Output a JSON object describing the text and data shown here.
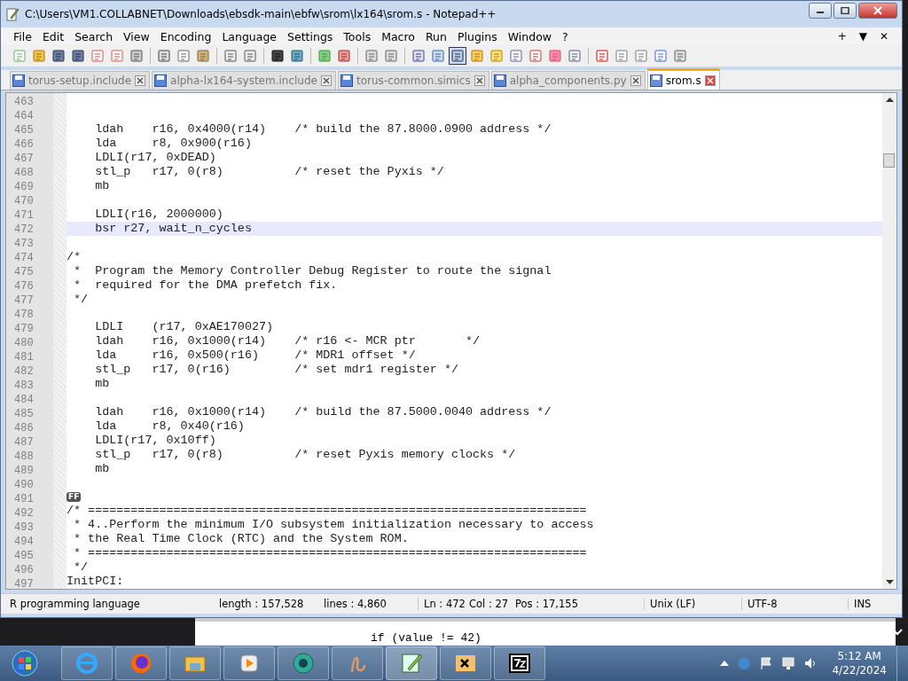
{
  "window": {
    "title": "C:\\Users\\VM1.COLLABNET\\Downloads\\ebsdk-main\\ebfw\\srom\\lx164\\srom.s - Notepad++"
  },
  "menu": [
    "File",
    "Edit",
    "Search",
    "View",
    "Encoding",
    "Language",
    "Settings",
    "Tools",
    "Macro",
    "Run",
    "Plugins",
    "Window",
    "?"
  ],
  "menu_extras": [
    "+",
    "▼",
    "✕"
  ],
  "tabs": [
    {
      "label": "torus-setup.include",
      "selected": false
    },
    {
      "label": "alpha-lx164-system.include",
      "selected": false
    },
    {
      "label": "torus-common.simics",
      "selected": false
    },
    {
      "label": "alpha_components.py",
      "selected": false
    },
    {
      "label": "srom.s",
      "selected": true
    }
  ],
  "editor": {
    "lines": [
      {
        "number": "463",
        "kind": "code",
        "selected": false
      },
      {
        "number": "464",
        "kind": "code",
        "selected": false
      },
      {
        "number": "465",
        "kind": "code",
        "text": "    ldah    r16, 0x4000(r14)    /* build the 87.8000.0900 address */",
        "selected": false
      },
      {
        "number": "466",
        "kind": "code",
        "text": "    lda     r8, 0x900(r16)",
        "selected": false
      },
      {
        "number": "467",
        "kind": "code",
        "text": "    LDLI(r17, 0xDEAD)",
        "selected": false
      },
      {
        "number": "468",
        "kind": "code",
        "text": "    stl_p   r17, 0(r8)          /* reset the Pyxis */",
        "selected": false
      },
      {
        "number": "469",
        "kind": "code",
        "text": "    mb",
        "selected": false
      },
      {
        "number": "470",
        "kind": "code",
        "selected": false
      },
      {
        "number": "471",
        "kind": "code",
        "text": "    LDLI(r16, 2000000)",
        "selected": false
      },
      {
        "number": "472",
        "kind": "code",
        "text": "    bsr r27, wait_n_cycles",
        "selected": true
      },
      {
        "number": "473",
        "kind": "code",
        "selected": false
      },
      {
        "number": "474",
        "kind": "code",
        "text": "/*",
        "selected": false
      },
      {
        "number": "475",
        "kind": "code",
        "text": " *  Program the Memory Controller Debug Register to route the signal",
        "selected": false
      },
      {
        "number": "476",
        "kind": "code",
        "text": " *  required for the DMA prefetch fix.",
        "selected": false
      },
      {
        "number": "477",
        "kind": "code",
        "text": " */",
        "selected": false
      },
      {
        "number": "478",
        "kind": "code",
        "selected": false
      },
      {
        "number": "479",
        "kind": "code",
        "text": "    LDLI    (r17, 0xAE170027)",
        "selected": false
      },
      {
        "number": "480",
        "kind": "code",
        "text": "    ldah    r16, 0x1000(r14)    /* r16 <- MCR ptr       */",
        "selected": false
      },
      {
        "number": "481",
        "kind": "code",
        "text": "    lda     r16, 0x500(r16)     /* MDR1 offset */",
        "selected": false
      },
      {
        "number": "482",
        "kind": "code",
        "text": "    stl_p   r17, 0(r16)         /* set mdr1 register */",
        "selected": false
      },
      {
        "number": "483",
        "kind": "code",
        "text": "    mb",
        "selected": false
      },
      {
        "number": "484",
        "kind": "code",
        "selected": false
      },
      {
        "number": "485",
        "kind": "code",
        "text": "    ldah    r16, 0x1000(r14)    /* build the 87.5000.0040 address */",
        "selected": false
      },
      {
        "number": "486",
        "kind": "code",
        "text": "    lda     r8, 0x40(r16)",
        "selected": false
      },
      {
        "number": "487",
        "kind": "code",
        "text": "    LDLI(r17, 0x10ff)",
        "selected": false
      },
      {
        "number": "488",
        "kind": "code",
        "text": "    stl_p   r17, 0(r8)          /* reset Pyxis memory clocks */",
        "selected": false
      },
      {
        "number": "489",
        "kind": "code",
        "text": "    mb",
        "selected": false
      },
      {
        "number": "490",
        "kind": "code",
        "selected": false
      },
      {
        "number": "491",
        "kind": "control",
        "text": "FF",
        "selected": false
      },
      {
        "number": "492",
        "kind": "code",
        "text": "/* ======================================================================",
        "selected": false
      },
      {
        "number": "493",
        "kind": "code",
        "text": " * 4..Perform the minimum I/O subsystem initialization necessary to access",
        "selected": false
      },
      {
        "number": "494",
        "kind": "code",
        "text": " * the Real Time Clock (RTC) and the System ROM.",
        "selected": false
      },
      {
        "number": "495",
        "kind": "code",
        "text": " * ======================================================================",
        "selected": false
      },
      {
        "number": "496",
        "kind": "code",
        "text": " */",
        "selected": false
      },
      {
        "number": "497",
        "kind": "code",
        "text": "InitPCI:",
        "selected": false
      }
    ]
  },
  "status_bar": {
    "language": "R programming language",
    "length": "length : 157,528",
    "lines": "lines : 4,860",
    "ln": "Ln : 472",
    "col": "Col : 27",
    "pos": "Pos : 17,155",
    "eol": "Unix (LF)",
    "encoding": "UTF-8",
    "mode": "INS"
  },
  "background_window": {
    "code_line": "if (value != 42)"
  },
  "taskbar": {
    "time": "5:12 AM",
    "date": "4/22/2024"
  }
}
